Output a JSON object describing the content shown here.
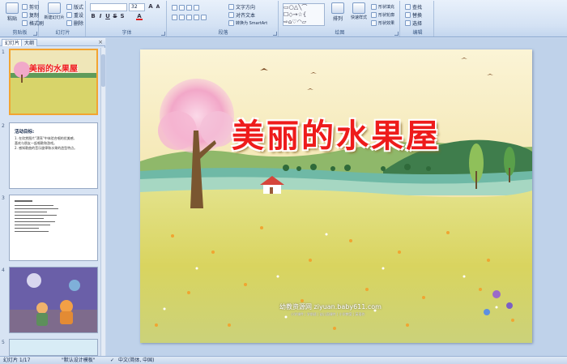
{
  "ribbon": {
    "clipboard": {
      "label": "剪贴板",
      "paste": "粘贴",
      "cut": "剪切",
      "copy": "复制",
      "format_painter": "格式刷"
    },
    "slides": {
      "label": "幻灯片",
      "new_slide": "新建幻灯片",
      "layout": "版式",
      "reset": "重设",
      "delete": "删除"
    },
    "font": {
      "label": "字体",
      "size_value": "32"
    },
    "paragraph": {
      "label": "段落",
      "text_direction": "文字方向",
      "align_text": "对齐文本",
      "smartart": "转换为 SmartArt"
    },
    "drawing": {
      "label": "绘图",
      "arrange": "排列",
      "quick_styles": "快速样式",
      "shape_fill": "形状填充",
      "shape_outline": "形状轮廓",
      "shape_effects": "形状效果"
    },
    "editing": {
      "label": "编辑",
      "find": "查找",
      "replace": "替换",
      "select": "选择"
    }
  },
  "left_pane": {
    "tab_slides": "幻灯片",
    "tab_outline": "大纲",
    "slide_numbers": [
      "1",
      "2",
      "3",
      "4",
      "5"
    ],
    "thumb1_title": "美丽的水果屋",
    "thumb2_heading": "活动目标:",
    "thumb2_lines": [
      "1. 在欣赏图片\"漂亮\"中体验合唱的优美感,",
      "   喜欢与朋友一起唱歌和游戏。",
      "2. 感知歌曲的音乐旋律和水果的造型特点。"
    ]
  },
  "slide": {
    "title": "美丽的水果屋",
    "watermark": "幼教资源网 ziyuan.baby611.com",
    "watermark_sub": "小学课件 | 学前班 | 幼儿园课件 | 小学教案 | 英语作"
  },
  "status_bar": {
    "slide_info": "幻灯片 1/17",
    "theme": "\"默认设计模板\"",
    "language": "中文(简体, 中国)"
  },
  "colors": {
    "title_red": "#ee1b1b",
    "selection_orange": "#f2a431",
    "ribbon_blue": "#d4e2f4"
  }
}
